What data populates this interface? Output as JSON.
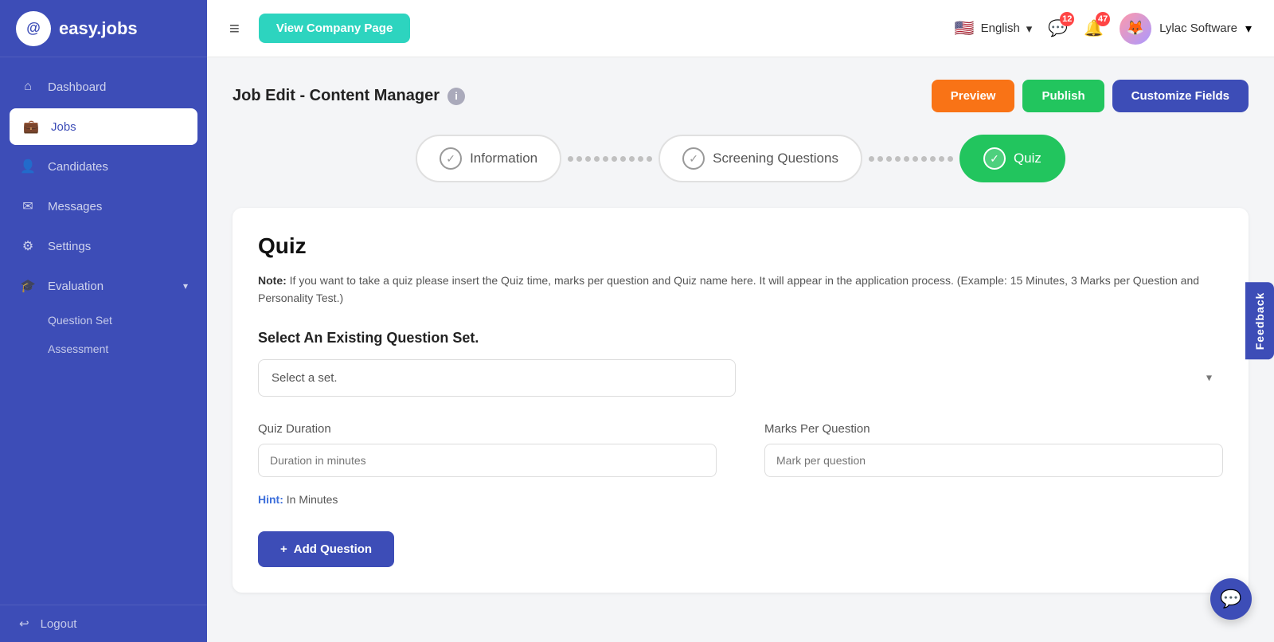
{
  "sidebar": {
    "logo_text": "easy.jobs",
    "logo_icon": "@",
    "nav_items": [
      {
        "id": "dashboard",
        "label": "Dashboard",
        "icon": "⌂",
        "active": false
      },
      {
        "id": "jobs",
        "label": "Jobs",
        "icon": "💼",
        "active": true
      },
      {
        "id": "candidates",
        "label": "Candidates",
        "icon": "👤",
        "active": false
      },
      {
        "id": "messages",
        "label": "Messages",
        "icon": "✉",
        "active": false
      },
      {
        "id": "settings",
        "label": "Settings",
        "icon": "⚙",
        "active": false
      },
      {
        "id": "evaluation",
        "label": "Evaluation",
        "icon": "🎓",
        "active": false,
        "has_chevron": true
      }
    ],
    "sub_items": [
      {
        "id": "question-set",
        "label": "Question Set"
      },
      {
        "id": "assessment",
        "label": "Assessment"
      }
    ],
    "logout_label": "Logout"
  },
  "topbar": {
    "menu_icon": "≡",
    "view_company_btn": "View Company Page",
    "language": "English",
    "chat_badge": "12",
    "notification_badge": "47",
    "user_name": "Lylac Software"
  },
  "page": {
    "title": "Job Edit - Content Manager",
    "preview_btn": "Preview",
    "publish_btn": "Publish",
    "customize_btn": "Customize Fields"
  },
  "wizard": {
    "steps": [
      {
        "id": "information",
        "label": "Information",
        "active": false,
        "icon": "✓"
      },
      {
        "id": "screening",
        "label": "Screening Questions",
        "active": false,
        "icon": "✓"
      },
      {
        "id": "quiz",
        "label": "Quiz",
        "active": true,
        "icon": "✓"
      }
    ]
  },
  "quiz": {
    "title": "Quiz",
    "note_label": "Note:",
    "note_text": " If you want to take a quiz please insert the Quiz time, marks per question and Quiz name here. It will appear in the application process. (Example: 15 Minutes, 3 Marks per Question and Personality Test.)",
    "select_section_label": "Select An Existing Question Set.",
    "select_placeholder": "Select a set.",
    "quiz_duration_label": "Quiz Duration",
    "marks_per_question_label": "Marks Per Question",
    "duration_placeholder": "Duration in minutes",
    "marks_placeholder": "Mark per question",
    "hint_label": "Hint:",
    "hint_text": " In Minutes",
    "add_question_btn": "+ Add Question"
  },
  "feedback": {
    "label": "Feedback"
  }
}
